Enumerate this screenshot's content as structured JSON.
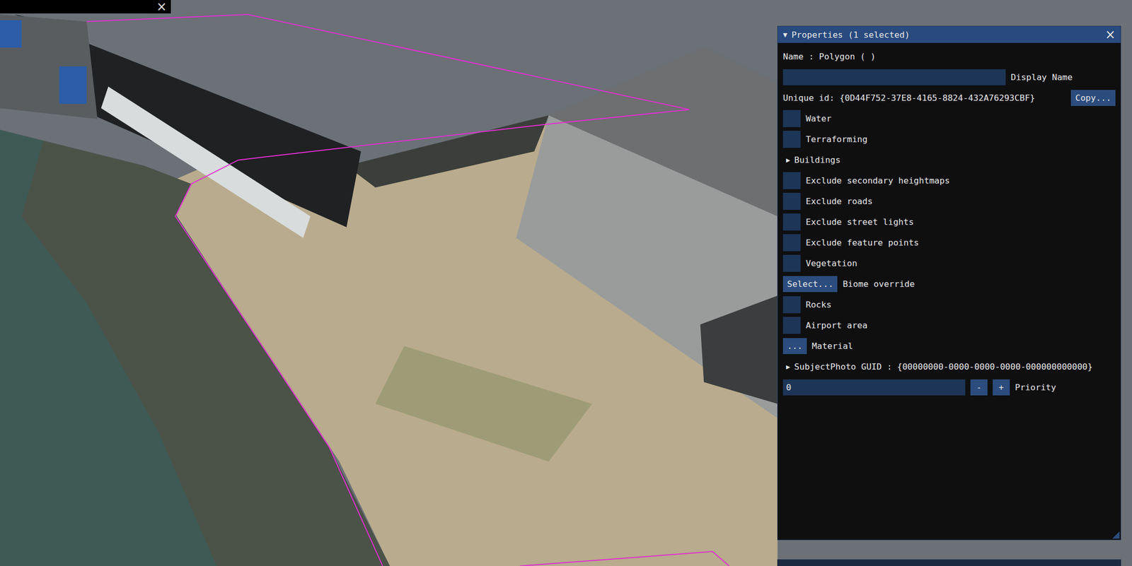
{
  "top_bar": {
    "close": "×"
  },
  "properties": {
    "title": "Properties (1 selected)",
    "collapse": "▼",
    "close": "×",
    "name_label": "Name : Polygon  ( )",
    "display_name": {
      "value": "",
      "label": "Display Name"
    },
    "unique_id": "Unique id: {0D44F752-37E8-4165-8824-432A76293CBF}",
    "copy_button": "Copy...",
    "rows": [
      {
        "kind": "checkbox",
        "label": "Water",
        "checked": false
      },
      {
        "kind": "checkbox",
        "label": "Terraforming",
        "checked": false
      },
      {
        "kind": "tree",
        "arrow": "▶",
        "label": "Buildings",
        "expanded": false
      },
      {
        "kind": "checkbox",
        "label": "Exclude secondary heightmaps",
        "checked": false
      },
      {
        "kind": "checkbox",
        "label": "Exclude roads",
        "checked": false
      },
      {
        "kind": "checkbox",
        "label": "Exclude street lights",
        "checked": false
      },
      {
        "kind": "checkbox",
        "label": "Exclude feature points",
        "checked": false
      },
      {
        "kind": "checkbox",
        "label": "Vegetation",
        "checked": false
      },
      {
        "kind": "button",
        "button": "Select...",
        "label": "Biome override"
      },
      {
        "kind": "checkbox",
        "label": "Rocks",
        "checked": false
      },
      {
        "kind": "checkbox",
        "label": "Airport area",
        "checked": false
      },
      {
        "kind": "button",
        "button": "...",
        "label": "Material"
      },
      {
        "kind": "tree",
        "arrow": "▶",
        "label": "SubjectPhoto GUID : {00000000-0000-0000-0000-000000000000}",
        "expanded": false
      },
      {
        "kind": "stepper",
        "value": "0",
        "minus": "-",
        "plus": "+",
        "label": "Priority"
      }
    ]
  }
}
